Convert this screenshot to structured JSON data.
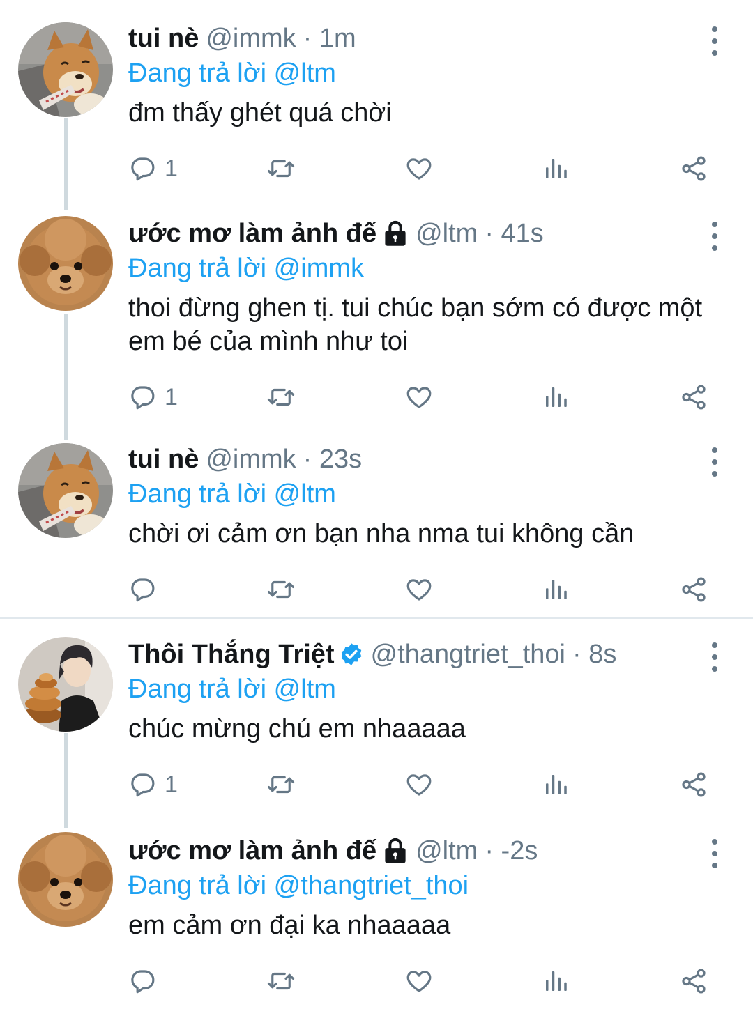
{
  "colors": {
    "accent": "#1da1f2",
    "muted": "#657786",
    "text": "#14171a",
    "divider": "#e1e8ed"
  },
  "icons": [
    "reply-icon",
    "retweet-icon",
    "like-icon",
    "analytics-icon",
    "share-icon",
    "more-icon",
    "lock-icon",
    "verified-icon"
  ],
  "tweets": [
    {
      "name": "tui nè",
      "handle": "@immk",
      "time": "· 1m",
      "reply_label": "Đang trả lời",
      "reply_to": "@ltm",
      "text": "đm thấy ghét quá chời",
      "reply_count": "1",
      "avatar": "shiba-dog"
    },
    {
      "name": "ước mơ làm ảnh đế",
      "handle": "@ltm",
      "time": "· 41s",
      "reply_label": "Đang trả lời",
      "reply_to": "@immk",
      "text": "thoi đừng ghen tị. tui chúc bạn sớm có được một em bé của mình như toi",
      "reply_count": "1",
      "avatar": "poodle-dog"
    },
    {
      "name": "tui nè",
      "handle": "@immk",
      "time": "· 23s",
      "reply_label": "Đang trả lời",
      "reply_to": "@ltm",
      "text": "chời ơi cảm ơn bạn nha nma tui không cần",
      "reply_count": "",
      "avatar": "shiba-dog"
    },
    {
      "name": "Thôi Thắng Triệt",
      "handle": "@thangtriet_thoi",
      "time": "· 8s",
      "reply_label": "Đang trả lời",
      "reply_to": "@ltm",
      "text": "chúc mừng chú em nhaaaaa",
      "reply_count": "1",
      "avatar": "person-with-cake"
    },
    {
      "name": "ước mơ làm ảnh đế",
      "handle": "@ltm",
      "time": "· -2s",
      "reply_label": "Đang trả lời",
      "reply_to": "@thangtriet_thoi",
      "text": "em cảm ơn đại ka nhaaaaa",
      "reply_count": "",
      "avatar": "poodle-dog"
    }
  ]
}
